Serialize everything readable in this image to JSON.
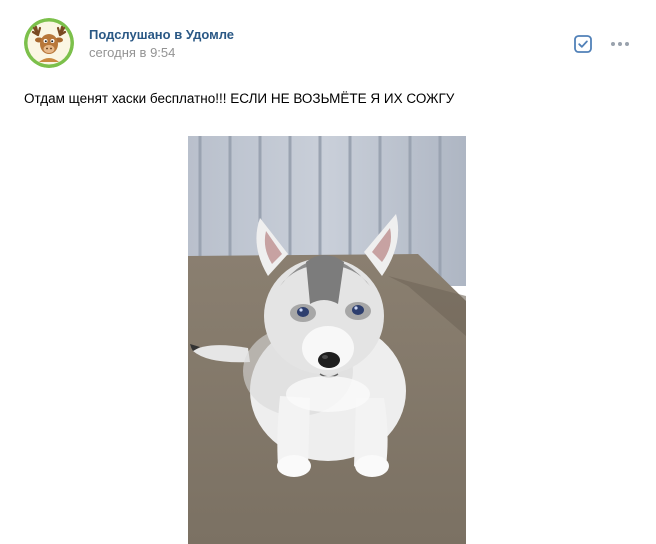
{
  "post": {
    "author": "Подслушано в Удомле",
    "time": "сегодня в 9:54",
    "text": "Отдам щенят хаски бесплатно!!! ЕСЛИ НЕ ВОЗЬМЁТЕ Я ИХ СОЖГУ",
    "avatar_icon": "moose-cartoon-avatar",
    "photo_subject": "husky puppy"
  },
  "actions": {
    "check_icon": "checkbox-icon",
    "more_icon": "more-dots-icon"
  },
  "colors": {
    "author_link": "#2a5885",
    "secondary_text": "#939393",
    "icon_accent": "#5181b8"
  }
}
